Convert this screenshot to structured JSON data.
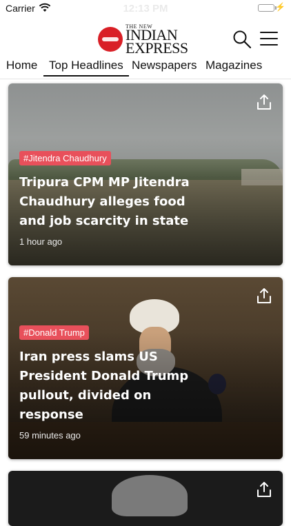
{
  "status_bar": {
    "carrier": "Carrier",
    "time": "12:13 PM",
    "battery_level": 0.65
  },
  "header": {
    "logo_small": "THE NEW",
    "logo_line1": "INDIAN",
    "logo_line2": "EXPRESS",
    "search_icon": "search-icon",
    "menu_icon": "hamburger-menu-icon"
  },
  "tabs": [
    {
      "label": "Home",
      "active": false
    },
    {
      "label": "Top Headlines",
      "active": true
    },
    {
      "label": "Newspapers",
      "active": false
    },
    {
      "label": "Magazines",
      "active": false
    }
  ],
  "articles": [
    {
      "tag": "#Jitendra Chaudhury",
      "headline_lines": [
        "Tripura CPM MP Jitendra",
        "Chaudhury alleges food",
        "and job scarcity in state"
      ],
      "time": "1 hour ago"
    },
    {
      "tag": "#Donald Trump",
      "headline_lines": [
        "Iran press slams US",
        "President Donald Trump",
        "pullout, divided on",
        "response"
      ],
      "time": "59 minutes ago"
    },
    {
      "tag": "",
      "headline_lines": [],
      "time": ""
    }
  ],
  "colors": {
    "tag_bg": "#e8505b",
    "logo_red": "#d91f26"
  }
}
